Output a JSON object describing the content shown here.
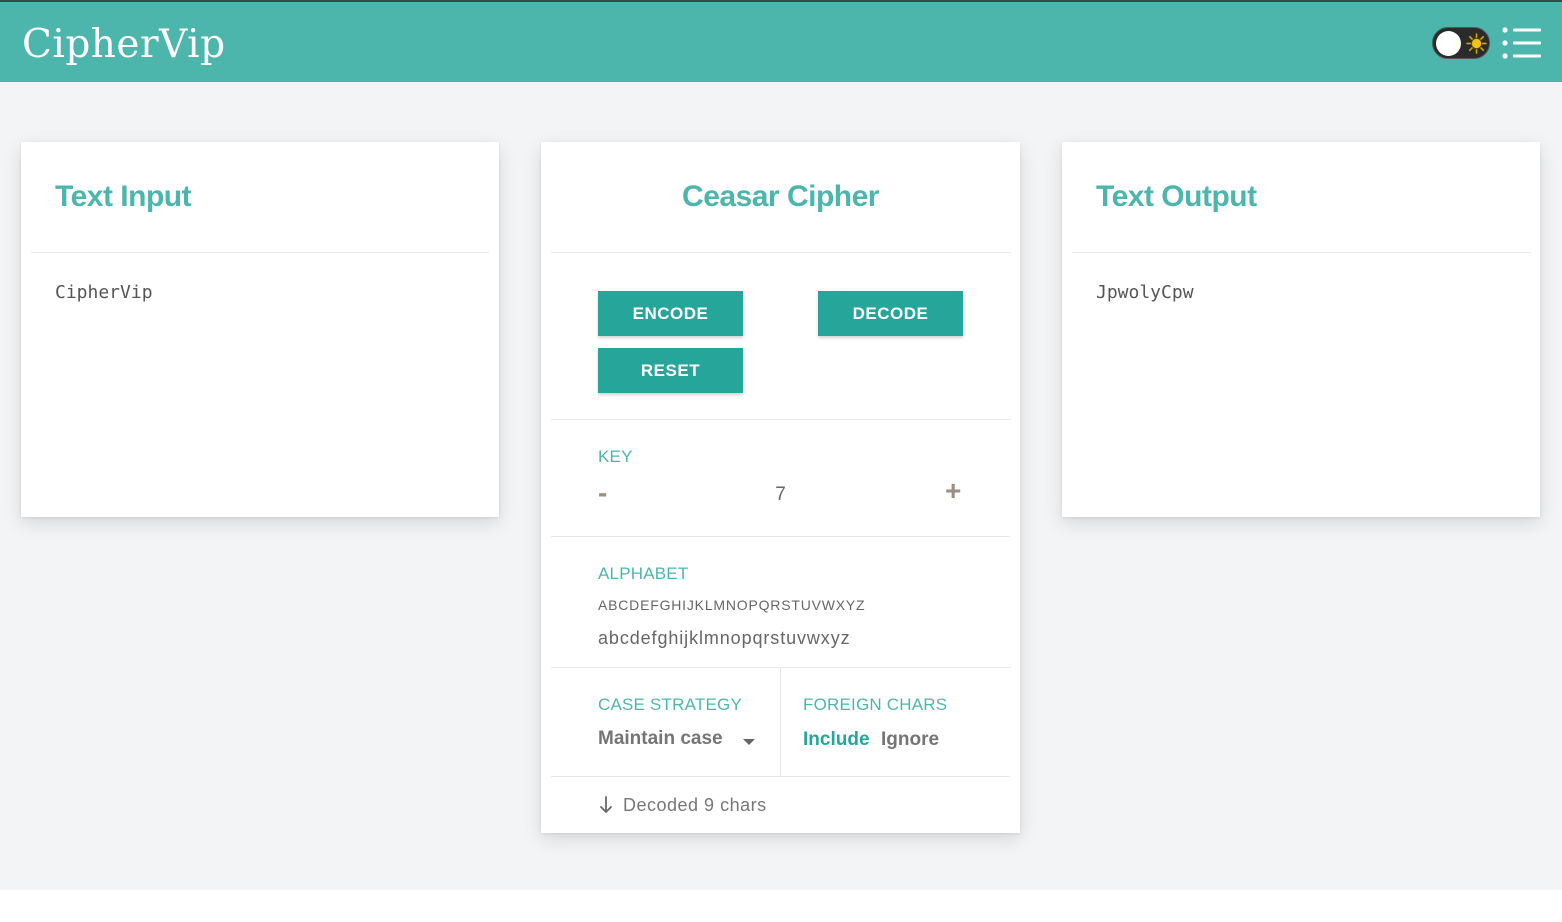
{
  "app": {
    "brand": "CipherVip"
  },
  "header": {
    "theme_toggle_icon": "sun-icon",
    "menu_icon": "menu-icon"
  },
  "input_card": {
    "title": "Text Input",
    "value": "CipherVip"
  },
  "cipher_card": {
    "title": "Ceasar Cipher",
    "buttons": {
      "encode": "ENCODE",
      "decode": "DECODE",
      "reset": "RESET"
    },
    "key": {
      "label": "KEY",
      "minus": "-",
      "value": "7",
      "plus": "+"
    },
    "alphabet": {
      "label": "ALPHABET",
      "upper": "ABCDEFGHIJKLMNOPQRSTUVWXYZ",
      "lower": "abcdefghijklmnopqrstuvwxyz"
    },
    "case_strategy": {
      "label": "CASE STRATEGY",
      "value": "Maintain case"
    },
    "foreign_chars": {
      "label": "FOREIGN CHARS",
      "include": "Include",
      "ignore": "Ignore",
      "selected": "Include"
    },
    "status": "Decoded 9 chars"
  },
  "output_card": {
    "title": "Text Output",
    "value": "JpwolyCpw"
  },
  "colors": {
    "brand": "#4db6ac",
    "button": "#26a69a",
    "background": "#f3f4f6"
  }
}
